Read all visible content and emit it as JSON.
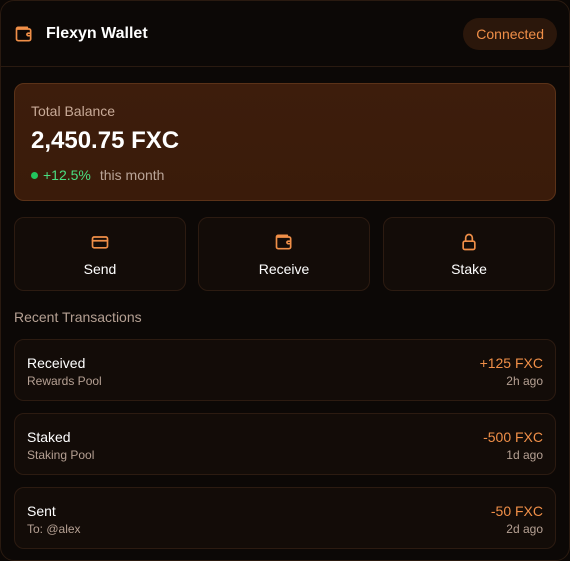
{
  "header": {
    "title": "Flexyn Wallet",
    "icon": "wallet-icon",
    "status": "Connected"
  },
  "balance": {
    "label": "Total Balance",
    "amount": "2,450.75 FXC",
    "change": "+12.5%",
    "period": "this month"
  },
  "actions": [
    {
      "label": "Send",
      "icon": "credit-card-icon"
    },
    {
      "label": "Receive",
      "icon": "wallet-icon"
    },
    {
      "label": "Stake",
      "icon": "lock-icon"
    }
  ],
  "transactions_title": "Recent Transactions",
  "transactions": [
    {
      "title": "Received",
      "sub": "Rewards Pool",
      "amount": "+125 FXC",
      "time": "2h ago"
    },
    {
      "title": "Staked",
      "sub": "Staking Pool",
      "amount": "-500 FXC",
      "time": "1d ago"
    },
    {
      "title": "Sent",
      "sub": "To: @alex",
      "amount": "-50 FXC",
      "time": "2d ago"
    }
  ],
  "colors": {
    "accent": "#f08f48",
    "positive": "#4ade80",
    "card_bg": "#3d1d0c",
    "background": "#0c0806"
  }
}
